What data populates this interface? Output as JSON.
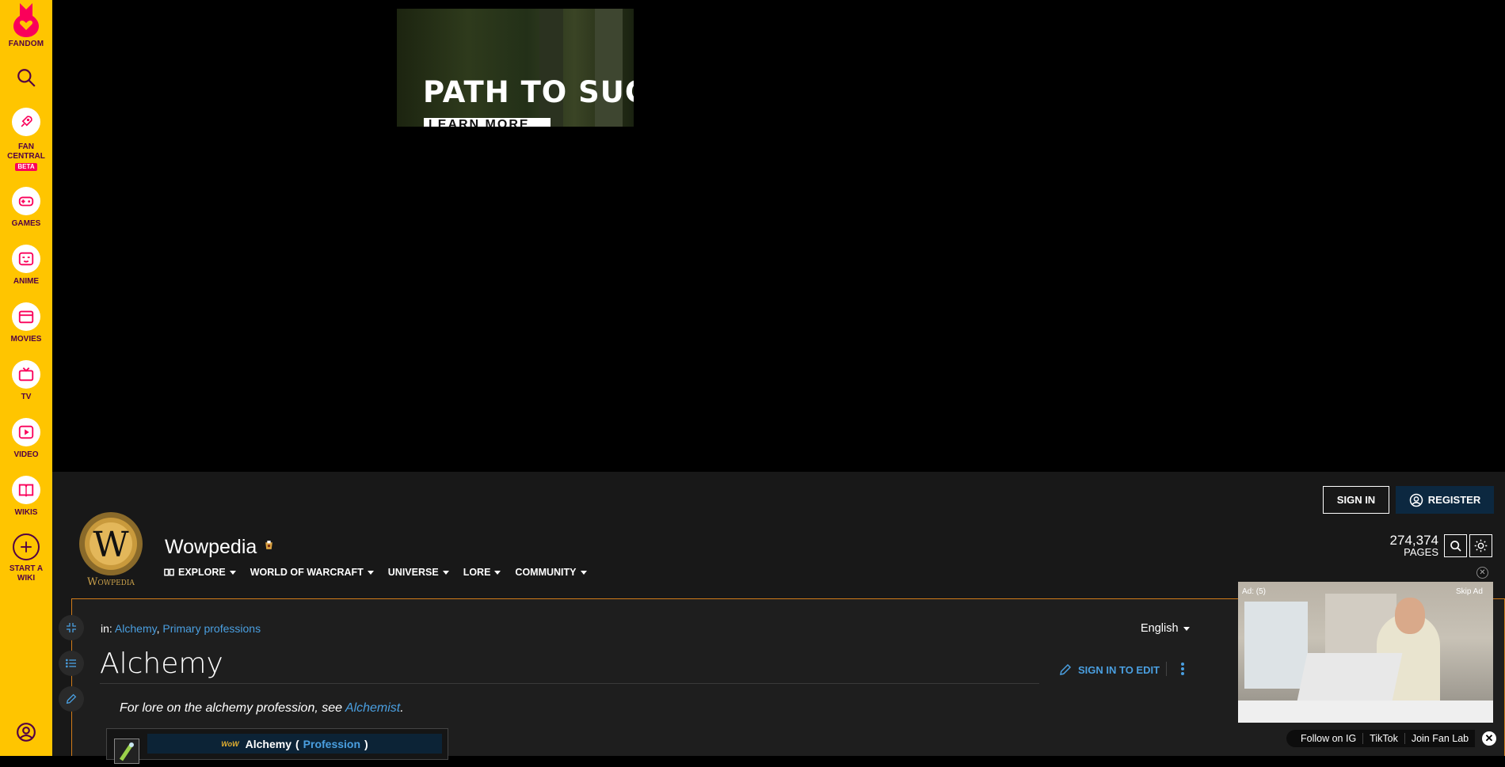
{
  "rail": {
    "logo_label": "FANDOM",
    "items": [
      {
        "label": "FAN CENTRAL",
        "badge": "BETA",
        "icon": "rocket-icon"
      },
      {
        "label": "GAMES",
        "icon": "gamepad-icon"
      },
      {
        "label": "ANIME",
        "icon": "anime-face-icon"
      },
      {
        "label": "MOVIES",
        "icon": "clapperboard-icon"
      },
      {
        "label": "TV",
        "icon": "tv-icon"
      },
      {
        "label": "VIDEO",
        "icon": "play-icon"
      },
      {
        "label": "WIKIS",
        "icon": "book-icon"
      },
      {
        "label": "START A WIKI",
        "icon": "plus-icon"
      }
    ],
    "colors": {
      "background": "#ffc500",
      "accent": "#fa005a",
      "text": "#520044"
    }
  },
  "top_ad": {
    "headline": "PATH TO SUCC",
    "cta": "LEARN MORE"
  },
  "header": {
    "sign_in": "SIGN IN",
    "register": "REGISTER",
    "wiki_name": "Wowpedia",
    "logo_text": "Wowpedia",
    "page_count": "274,374",
    "page_count_label": "PAGES",
    "nav": [
      {
        "label": "EXPLORE"
      },
      {
        "label": "WORLD OF WARCRAFT"
      },
      {
        "label": "UNIVERSE"
      },
      {
        "label": "LORE"
      },
      {
        "label": "COMMUNITY"
      }
    ]
  },
  "article": {
    "categories_prefix": "in:",
    "categories": [
      "Alchemy",
      "Primary professions"
    ],
    "language": "English",
    "title": "Alchemy",
    "edit_label": "SIGN IN TO EDIT",
    "hatnote_text": "For lore on the alchemy profession, see",
    "hatnote_link": "Alchemist",
    "infobox": {
      "badge": "WoW",
      "name": "Alchemy",
      "type": "Profession"
    }
  },
  "video_ad": {
    "label": "Ad: (5)",
    "skip": "Skip Ad"
  },
  "social": {
    "items": [
      "Follow on IG",
      "TikTok",
      "Join Fan Lab"
    ]
  },
  "colors": {
    "link": "#4a9fe0",
    "border": "#d27c1a",
    "register_bg": "#0c2840"
  }
}
